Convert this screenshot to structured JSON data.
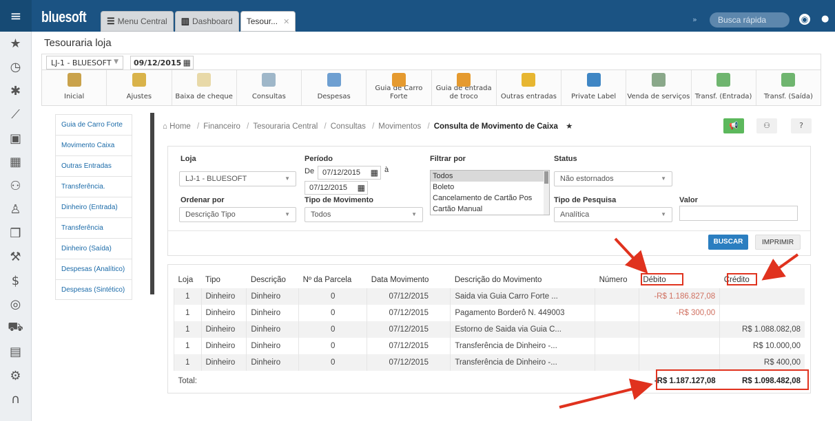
{
  "app": {
    "brand": "bluesoft",
    "tabs": [
      {
        "label": "Menu Central",
        "icon": "list-icon"
      },
      {
        "label": "Dashboard",
        "icon": "bar-chart-icon"
      },
      {
        "label": "Tesour...",
        "icon": ""
      }
    ],
    "quick_search_placeholder": "Busca rápida"
  },
  "page": {
    "title": "Tesouraria loja",
    "store": "LJ-1 - BLUESOFT",
    "date": "09/12/2015"
  },
  "toolbar": [
    {
      "label": "Inicial",
      "icon": "home-icon",
      "color": "#c9a24b"
    },
    {
      "label": "Ajustes",
      "icon": "pencil-icon",
      "color": "#d9b34a"
    },
    {
      "label": "Baixa de cheque",
      "icon": "cheque-icon",
      "color": "#e8d9a8"
    },
    {
      "label": "Consultas",
      "icon": "magnifier-icon",
      "color": "#9fb7c9"
    },
    {
      "label": "Despesas",
      "icon": "notepad-icon",
      "color": "#6e9fd1"
    },
    {
      "label": "Guia de Carro Forte",
      "icon": "truck-icon",
      "color": "#e59a2f"
    },
    {
      "label": "Guia de entrada de troco",
      "icon": "truck-plus-icon",
      "color": "#e59a2f"
    },
    {
      "label": "Outras entradas",
      "icon": "coins-plus-icon",
      "color": "#e7b631"
    },
    {
      "label": "Private Label",
      "icon": "card-icon",
      "color": "#3f86c4"
    },
    {
      "label": "Venda de serviços",
      "icon": "trash-service-icon",
      "color": "#8aa88a"
    },
    {
      "label": "Transf. (Entrada)",
      "icon": "money-plus-icon",
      "color": "#6fb56f"
    },
    {
      "label": "Transf. (Saída)",
      "icon": "money-minus-icon",
      "color": "#6fb56f"
    }
  ],
  "subnav": [
    "Guia de Carro Forte",
    "Movimento Caixa",
    "Outras Entradas",
    "Transferência.",
    "Dinheiro (Entrada)",
    "Transferência",
    "Dinheiro (Saída)",
    "Despesas (Analítico)",
    "Despesas (Sintético)"
  ],
  "breadcrumb": {
    "home": "Home",
    "items": [
      "Financeiro",
      "Tesouraria Central",
      "Consultas",
      "Movimentos"
    ],
    "current": "Consulta de Movimento de Caixa"
  },
  "filter": {
    "loja_label": "Loja",
    "loja_value": "LJ-1 - BLUESOFT",
    "periodo_label": "Período",
    "de_label": "De",
    "date_from": "07/12/2015",
    "a_label": "à",
    "date_to": "07/12/2015",
    "filtrar_label": "Filtrar por",
    "filtrar_options": [
      "Todos",
      "Boleto",
      "Cancelamento de Cartão Pos",
      "Cartão Manual"
    ],
    "status_label": "Status",
    "status_value": "Não estornados",
    "ordenar_label": "Ordenar por",
    "ordenar_value": "Descrição Tipo",
    "tipo_mov_label": "Tipo de Movimento",
    "tipo_mov_value": "Todos",
    "tipo_pesq_label": "Tipo de Pesquisa",
    "tipo_pesq_value": "Analítica",
    "valor_label": "Valor",
    "valor_value": "",
    "buscar": "BUSCAR",
    "imprimir": "IMPRIMIR"
  },
  "table": {
    "headers": [
      "Loja",
      "Tipo",
      "Descrição",
      "Nº da Parcela",
      "Data Movimento",
      "Descrição do Movimento",
      "Número",
      "Débito",
      "Crédito"
    ],
    "rows": [
      [
        "1",
        "Dinheiro",
        "Dinheiro",
        "0",
        "07/12/2015",
        "Saida via Guia Carro Forte ...",
        "",
        "-R$ 1.186.827,08",
        ""
      ],
      [
        "1",
        "Dinheiro",
        "Dinheiro",
        "0",
        "07/12/2015",
        "Pagamento Borderô N. 449003",
        "",
        "-R$ 300,00",
        ""
      ],
      [
        "1",
        "Dinheiro",
        "Dinheiro",
        "0",
        "07/12/2015",
        "Estorno de Saida via Guia C...",
        "",
        "",
        "R$ 1.088.082,08"
      ],
      [
        "1",
        "Dinheiro",
        "Dinheiro",
        "0",
        "07/12/2015",
        "Transferência de Dinheiro -...",
        "",
        "",
        "R$ 10.000,00"
      ],
      [
        "1",
        "Dinheiro",
        "Dinheiro",
        "0",
        "07/12/2015",
        "Transferência de Dinheiro -...",
        "",
        "",
        "R$ 400,00"
      ]
    ],
    "total_label": "Total:",
    "total_debito": "-R$ 1.187.127,08",
    "total_credito": "R$ 1.098.482,08"
  },
  "colors": {
    "topbar": "#1b5383",
    "highlight": "#e0321e",
    "debit": "#d07060",
    "primary_button": "#2b7ec0"
  }
}
